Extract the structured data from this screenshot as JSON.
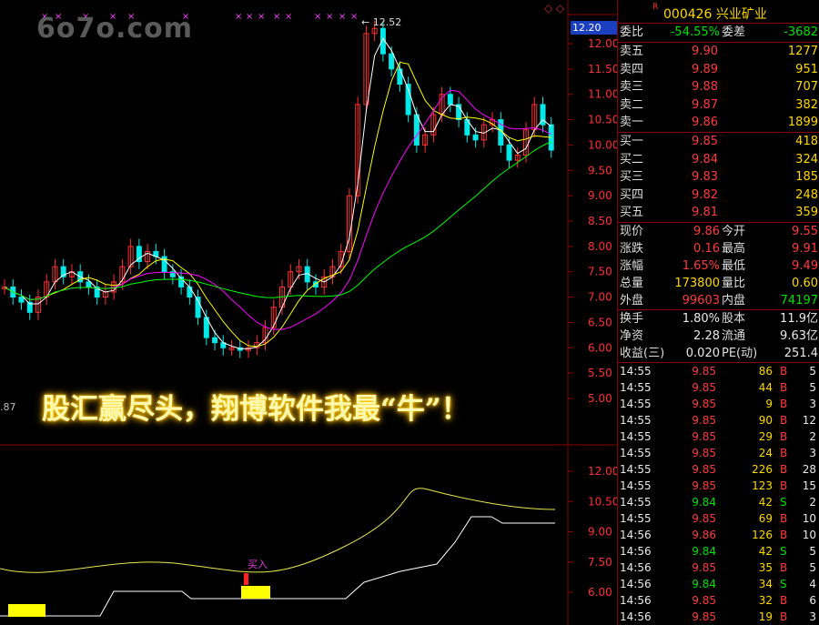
{
  "watermark": "6o7o.com",
  "chart": {
    "peak_label": "12.52",
    "current_price_badge": "12.20",
    "left_value": ".87",
    "buy_signal": "买入",
    "slogan": "股汇赢尽头，翔博软件我最“牛”！",
    "price_axis": [
      "12.00",
      "11.50",
      "11.00",
      "10.50",
      "10.00",
      "9.50",
      "9.00",
      "8.50",
      "8.00",
      "7.50",
      "7.00",
      "6.50",
      "6.00",
      "5.50",
      "5.00"
    ],
    "indicator_axis": [
      "12.00",
      "10.50",
      "9.00",
      "7.50",
      "6.00"
    ],
    "colors": {
      "up": "#ff3030",
      "down": "#00e8e8",
      "ma5": "#ffffff",
      "ma10": "#ffff00",
      "ma20": "#ff00ff",
      "ma60": "#00ff00",
      "grid": "#8b0000"
    }
  },
  "quote": {
    "r_mark": "R",
    "code_name": "000426 兴业矿业",
    "weibi": {
      "label": "委比",
      "value": "-54.55%",
      "label2": "委差",
      "value2": "-3682"
    },
    "sells": [
      {
        "label": "卖五",
        "price": "9.90",
        "vol": "1277"
      },
      {
        "label": "卖四",
        "price": "9.89",
        "vol": "951"
      },
      {
        "label": "卖三",
        "price": "9.88",
        "vol": "707"
      },
      {
        "label": "卖二",
        "price": "9.87",
        "vol": "382"
      },
      {
        "label": "卖一",
        "price": "9.86",
        "vol": "1899"
      }
    ],
    "buys": [
      {
        "label": "买一",
        "price": "9.85",
        "vol": "418"
      },
      {
        "label": "买二",
        "price": "9.84",
        "vol": "324"
      },
      {
        "label": "买三",
        "price": "9.83",
        "vol": "185"
      },
      {
        "label": "买四",
        "price": "9.82",
        "vol": "248"
      },
      {
        "label": "买五",
        "price": "9.81",
        "vol": "359"
      }
    ],
    "stats": [
      {
        "l1": "现价",
        "v1": "9.86",
        "c1": "red",
        "l2": "今开",
        "v2": "9.55",
        "c2": "red"
      },
      {
        "l1": "涨跌",
        "v1": "0.16",
        "c1": "red",
        "l2": "最高",
        "v2": "9.91",
        "c2": "red"
      },
      {
        "l1": "涨幅",
        "v1": "1.65%",
        "c1": "red",
        "l2": "最低",
        "v2": "9.49",
        "c2": "red"
      },
      {
        "l1": "总量",
        "v1": "173800",
        "c1": "yel",
        "l2": "量比",
        "v2": "0.60",
        "c2": "yel"
      },
      {
        "l1": "外盘",
        "v1": "99603",
        "c1": "red",
        "l2": "内盘",
        "v2": "74197",
        "c2": "green"
      }
    ],
    "stats2": [
      {
        "l1": "换手",
        "v1": "1.80%",
        "l2": "股本",
        "v2": "11.9亿"
      },
      {
        "l1": "净资",
        "v1": "2.28",
        "l2": "流通",
        "v2": "9.63亿"
      },
      {
        "l1": "收益(三)",
        "v1": "0.020",
        "l2": "PE(动)",
        "v2": "251.4"
      }
    ],
    "ticks": [
      {
        "time": "14:55",
        "price": "9.85",
        "vol": "86",
        "side": "B",
        "n": "5"
      },
      {
        "time": "14:55",
        "price": "9.85",
        "vol": "44",
        "side": "B",
        "n": "5"
      },
      {
        "time": "14:55",
        "price": "9.85",
        "vol": "9",
        "side": "B",
        "n": "3"
      },
      {
        "time": "14:55",
        "price": "9.85",
        "vol": "90",
        "side": "B",
        "n": "12"
      },
      {
        "time": "14:55",
        "price": "9.85",
        "vol": "29",
        "side": "B",
        "n": "2"
      },
      {
        "time": "14:55",
        "price": "9.85",
        "vol": "24",
        "side": "B",
        "n": "3"
      },
      {
        "time": "14:55",
        "price": "9.85",
        "vol": "226",
        "side": "B",
        "n": "28"
      },
      {
        "time": "14:55",
        "price": "9.85",
        "vol": "123",
        "side": "B",
        "n": "15"
      },
      {
        "time": "14:55",
        "price": "9.84",
        "vol": "42",
        "side": "S",
        "n": "2"
      },
      {
        "time": "14:55",
        "price": "9.85",
        "vol": "69",
        "side": "B",
        "n": "10"
      },
      {
        "time": "14:56",
        "price": "9.86",
        "vol": "126",
        "side": "B",
        "n": "10"
      },
      {
        "time": "14:56",
        "price": "9.84",
        "vol": "42",
        "side": "S",
        "n": "5"
      },
      {
        "time": "14:56",
        "price": "9.85",
        "vol": "35",
        "side": "B",
        "n": "5"
      },
      {
        "time": "14:56",
        "price": "9.84",
        "vol": "34",
        "side": "S",
        "n": "4"
      },
      {
        "time": "14:56",
        "price": "9.85",
        "vol": "32",
        "side": "B",
        "n": "6"
      },
      {
        "time": "14:56",
        "price": "9.85",
        "vol": "19",
        "side": "B",
        "n": "3"
      }
    ]
  }
}
